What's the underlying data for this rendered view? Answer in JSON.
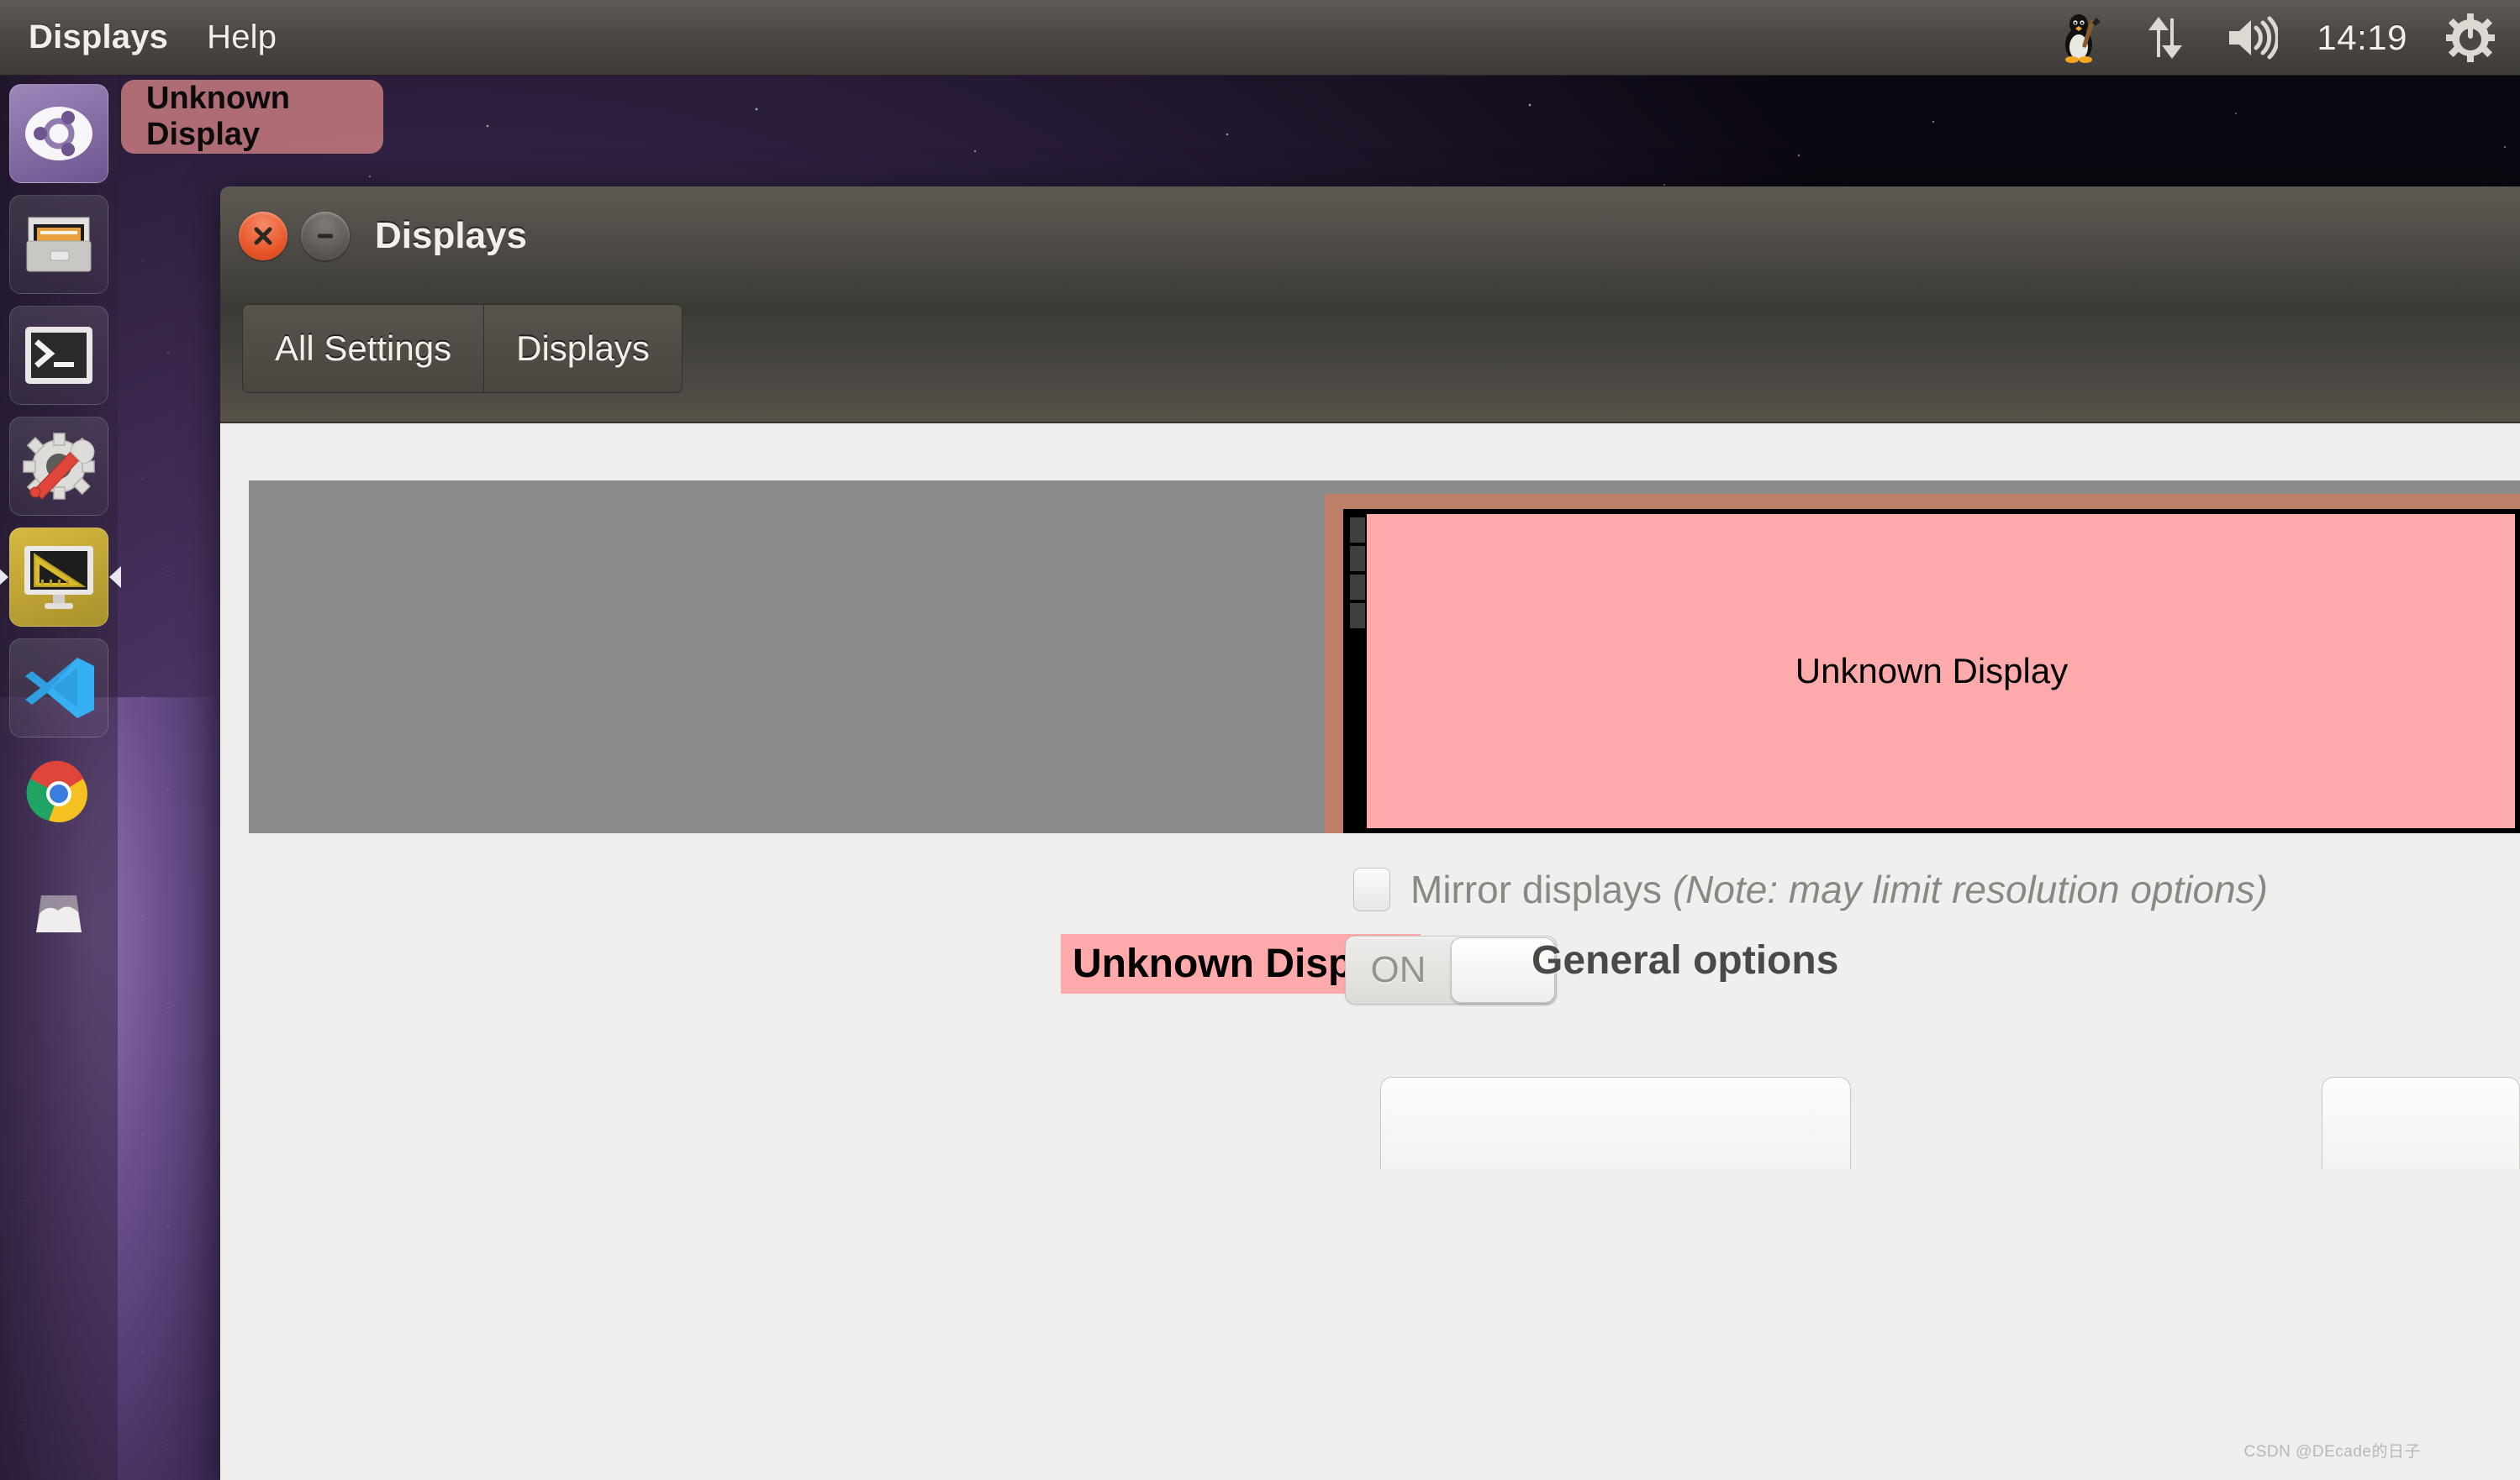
{
  "panel": {
    "menu_items": [
      {
        "label": "Displays",
        "bold": true
      },
      {
        "label": "Help",
        "bold": false
      }
    ],
    "clock": "14:19",
    "icons": [
      {
        "name": "tux-penguin-icon"
      },
      {
        "name": "network-updown-icon"
      },
      {
        "name": "volume-icon"
      },
      {
        "name": "power-gear-icon"
      }
    ]
  },
  "tooltip": {
    "text": "Unknown Display"
  },
  "launcher": {
    "items": [
      {
        "name": "ubuntu-dash",
        "label": "Ubuntu Dash"
      },
      {
        "name": "files",
        "label": "Files"
      },
      {
        "name": "terminal",
        "label": "Terminal"
      },
      {
        "name": "system-settings",
        "label": "System Settings"
      },
      {
        "name": "displays",
        "label": "Displays",
        "active": true
      },
      {
        "name": "vscode",
        "label": "Visual Studio Code"
      },
      {
        "name": "chrome",
        "label": "Google Chrome"
      },
      {
        "name": "trash",
        "label": "Trash"
      }
    ]
  },
  "window": {
    "title": "Displays",
    "close_label": "Close",
    "minimize_label": "Minimize",
    "toolbar": {
      "all_settings": "All Settings",
      "displays": "Displays"
    }
  },
  "main": {
    "monitor_preview": {
      "label": "Unknown Display",
      "screen_color": "#ffaaaa",
      "bezel_color": "#bd7f66",
      "canvas_color": "#8b8b8b"
    },
    "mirror": {
      "label": "Mirror displays",
      "note": "(Note: may limit resolution options)",
      "checked": false
    },
    "display_row": {
      "name": "Unknown Display",
      "toggle_state": "ON",
      "highlight_color": "#ffaaaa"
    },
    "general_options_title": "General options"
  },
  "watermark": "CSDN @DEcade的日子"
}
